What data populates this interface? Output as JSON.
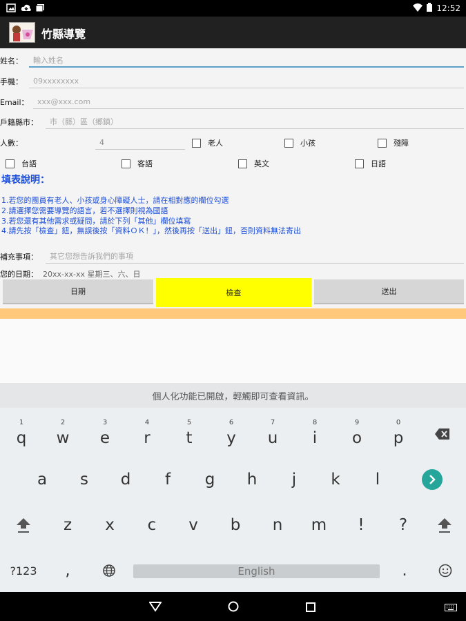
{
  "status": {
    "time": "12:52"
  },
  "app": {
    "title": "竹縣導覽"
  },
  "form": {
    "name": {
      "label": "姓名：",
      "placeholder": "輸入姓名"
    },
    "phone": {
      "label": "手機：",
      "placeholder": "09xxxxxxxx"
    },
    "email": {
      "label": "Email：",
      "placeholder": "xxx@xxx.com"
    },
    "city": {
      "label": "戶籍縣市：",
      "placeholder": "市（縣）區（鄉鎮）"
    },
    "count": {
      "label": "人數：",
      "value": "4"
    },
    "groups": [
      "老人",
      "小孩",
      "殘障"
    ],
    "languages": [
      "台語",
      "客語",
      "英文",
      "日語"
    ],
    "instructions_title": "填表說明：",
    "instructions": [
      "1.若您的團員有老人、小孩或身心障礙人士，請在相對應的欄位勾選",
      "2.請選擇您需要導覽的語言，若不選擇則視為國語",
      "3.若您還有其他需求或疑問，請於下列「其他」欄位填寫",
      "4.請先按「檢查」鈕，無誤後按「資料ＯＫ！」，然後再按「送出」鈕，否則資料無法寄出"
    ],
    "notes": {
      "label": "補充事項：",
      "placeholder": "其它您想告訴我們的事項"
    },
    "date": {
      "label": "您的日期：",
      "value": "20xx-xx-xx 星期三、六、日"
    },
    "buttons": {
      "date": "日期",
      "check": "檢查",
      "send": "送出"
    }
  },
  "keyboard": {
    "suggestion": "個人化功能已開啟，輕觸即可查看資訊。",
    "row1": [
      "q",
      "w",
      "e",
      "r",
      "t",
      "y",
      "u",
      "i",
      "o",
      "p"
    ],
    "row1_hints": [
      "1",
      "2",
      "3",
      "4",
      "5",
      "6",
      "7",
      "8",
      "9",
      "0"
    ],
    "row2": [
      "a",
      "s",
      "d",
      "f",
      "g",
      "h",
      "j",
      "k",
      "l"
    ],
    "row3": [
      "z",
      "x",
      "c",
      "v",
      "b",
      "n",
      "m",
      "!",
      "?"
    ],
    "symbols": "?123",
    "comma": ",",
    "period": ".",
    "space": "English"
  },
  "colors": {
    "check_button": "#ffff00",
    "instructions": "#1d4fd8",
    "accent_strip": "#ffc87a",
    "enter_key": "#26a69a"
  }
}
